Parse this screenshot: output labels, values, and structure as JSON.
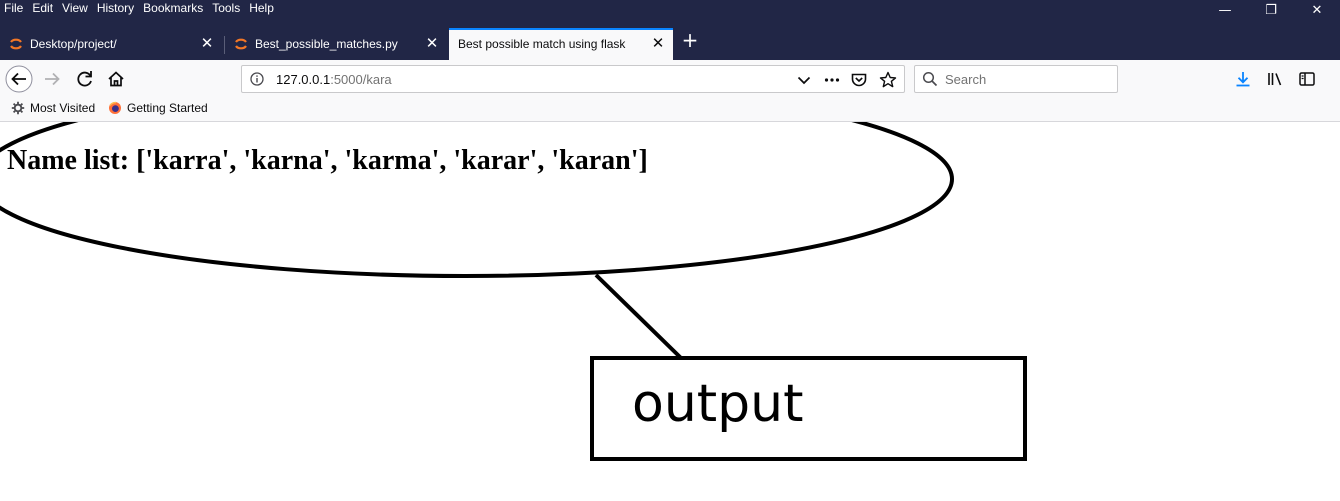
{
  "menubar": {
    "items": [
      "File",
      "Edit",
      "View",
      "History",
      "Bookmarks",
      "Tools",
      "Help"
    ]
  },
  "window_controls": {
    "minimize": "—",
    "restore": "❐",
    "close": "✕"
  },
  "tabs": [
    {
      "title": "Desktop/project/",
      "icon": "jupyter-icon",
      "active": false
    },
    {
      "title": "Best_possible_matches.py",
      "icon": "jupyter-icon",
      "active": false
    },
    {
      "title": "Best possible match using flask",
      "icon": "none",
      "active": true
    }
  ],
  "tab_close_glyph": "✕",
  "new_tab_glyph": "+",
  "urlbar": {
    "host": "127.0.0.1",
    "rest": ":5000/kara"
  },
  "search": {
    "placeholder": "Search"
  },
  "bookmarks": [
    {
      "label": "Most Visited",
      "icon": "gear-icon"
    },
    {
      "label": "Getting Started",
      "icon": "firefox-icon"
    }
  ],
  "page": {
    "heading": "Name list: ['karra', 'karna', 'karma', 'karar', 'karan']"
  },
  "annotation": {
    "label": "output"
  },
  "colors": {
    "chrome_dark": "#212646",
    "toolbar": "#f9f9fa",
    "accent": "#0a84ff",
    "jupyter_orange": "#f37726"
  }
}
